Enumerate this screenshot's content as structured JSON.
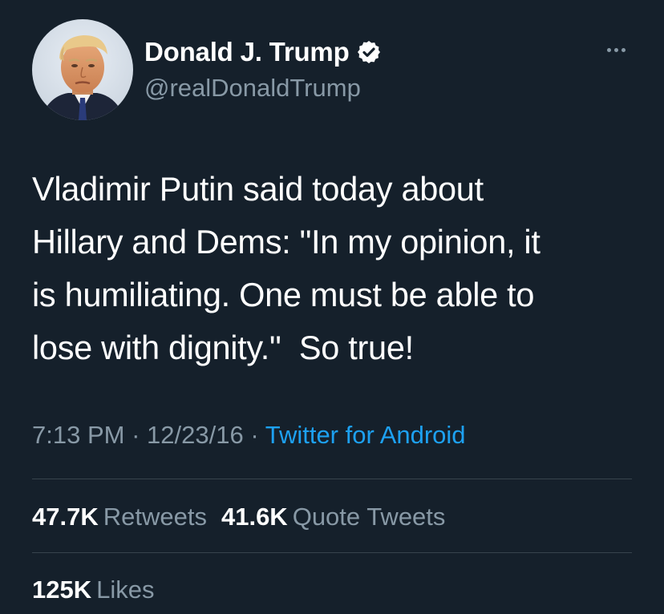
{
  "user": {
    "display_name": "Donald J. Trump",
    "handle": "@realDonaldTrump",
    "verified_icon": "verified-badge-icon",
    "avatar_icon": "profile-avatar"
  },
  "tweet": {
    "text_lines": [
      "Vladimir Putin said today about",
      "Hillary and Dems: \"In my opinion, it",
      "is humiliating. One must be able to",
      "lose with dignity.\"  So true!"
    ],
    "time": "7:13 PM",
    "separator": "·",
    "date": "12/23/16",
    "source": "Twitter for Android"
  },
  "stats": {
    "retweets_count": "47.7K",
    "retweets_label": "Retweets",
    "quotes_count": "41.6K",
    "quotes_label": "Quote Tweets",
    "likes_count": "125K",
    "likes_label": "Likes"
  },
  "colors": {
    "background": "#15202b",
    "text": "#ffffff",
    "secondary": "#8899a6",
    "accent": "#1da1f2",
    "divider": "#38444d"
  }
}
